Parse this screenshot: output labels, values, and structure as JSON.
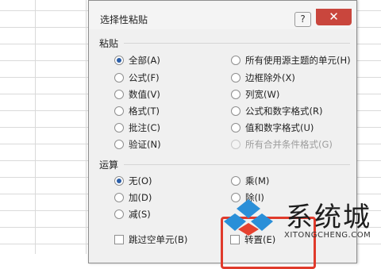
{
  "dialog": {
    "title": "选择性粘贴",
    "help_label": "?",
    "close_label": "✕"
  },
  "paste": {
    "group_label": "粘贴",
    "selected": "全部(A)",
    "left_options": [
      "全部(A)",
      "公式(F)",
      "数值(V)",
      "格式(T)",
      "批注(C)",
      "验证(N)"
    ],
    "right_options": [
      "所有使用源主题的单元(H)",
      "边框除外(X)",
      "列宽(W)",
      "公式和数字格式(R)",
      "值和数字格式(U)",
      "所有合并条件格式(G)"
    ],
    "disabled": [
      "所有合并条件格式(G)"
    ]
  },
  "operation": {
    "group_label": "运算",
    "selected": "无(O)",
    "left_options": [
      "无(O)",
      "加(D)",
      "减(S)"
    ],
    "right_options": [
      "乘(M)",
      "除(I)"
    ]
  },
  "checkboxes": {
    "skip_blanks": "跳过空单元(B)",
    "transpose": "转置(E)"
  },
  "watermark": {
    "brand": "系统城",
    "url": "XITONGCHENG.COM"
  },
  "colors": {
    "highlight": "#e03a2b",
    "close_button": "#c9463d",
    "radio_dot": "#2b5ea8",
    "logo_blue": "#2a8fd8",
    "logo_red": "#e5412f"
  }
}
